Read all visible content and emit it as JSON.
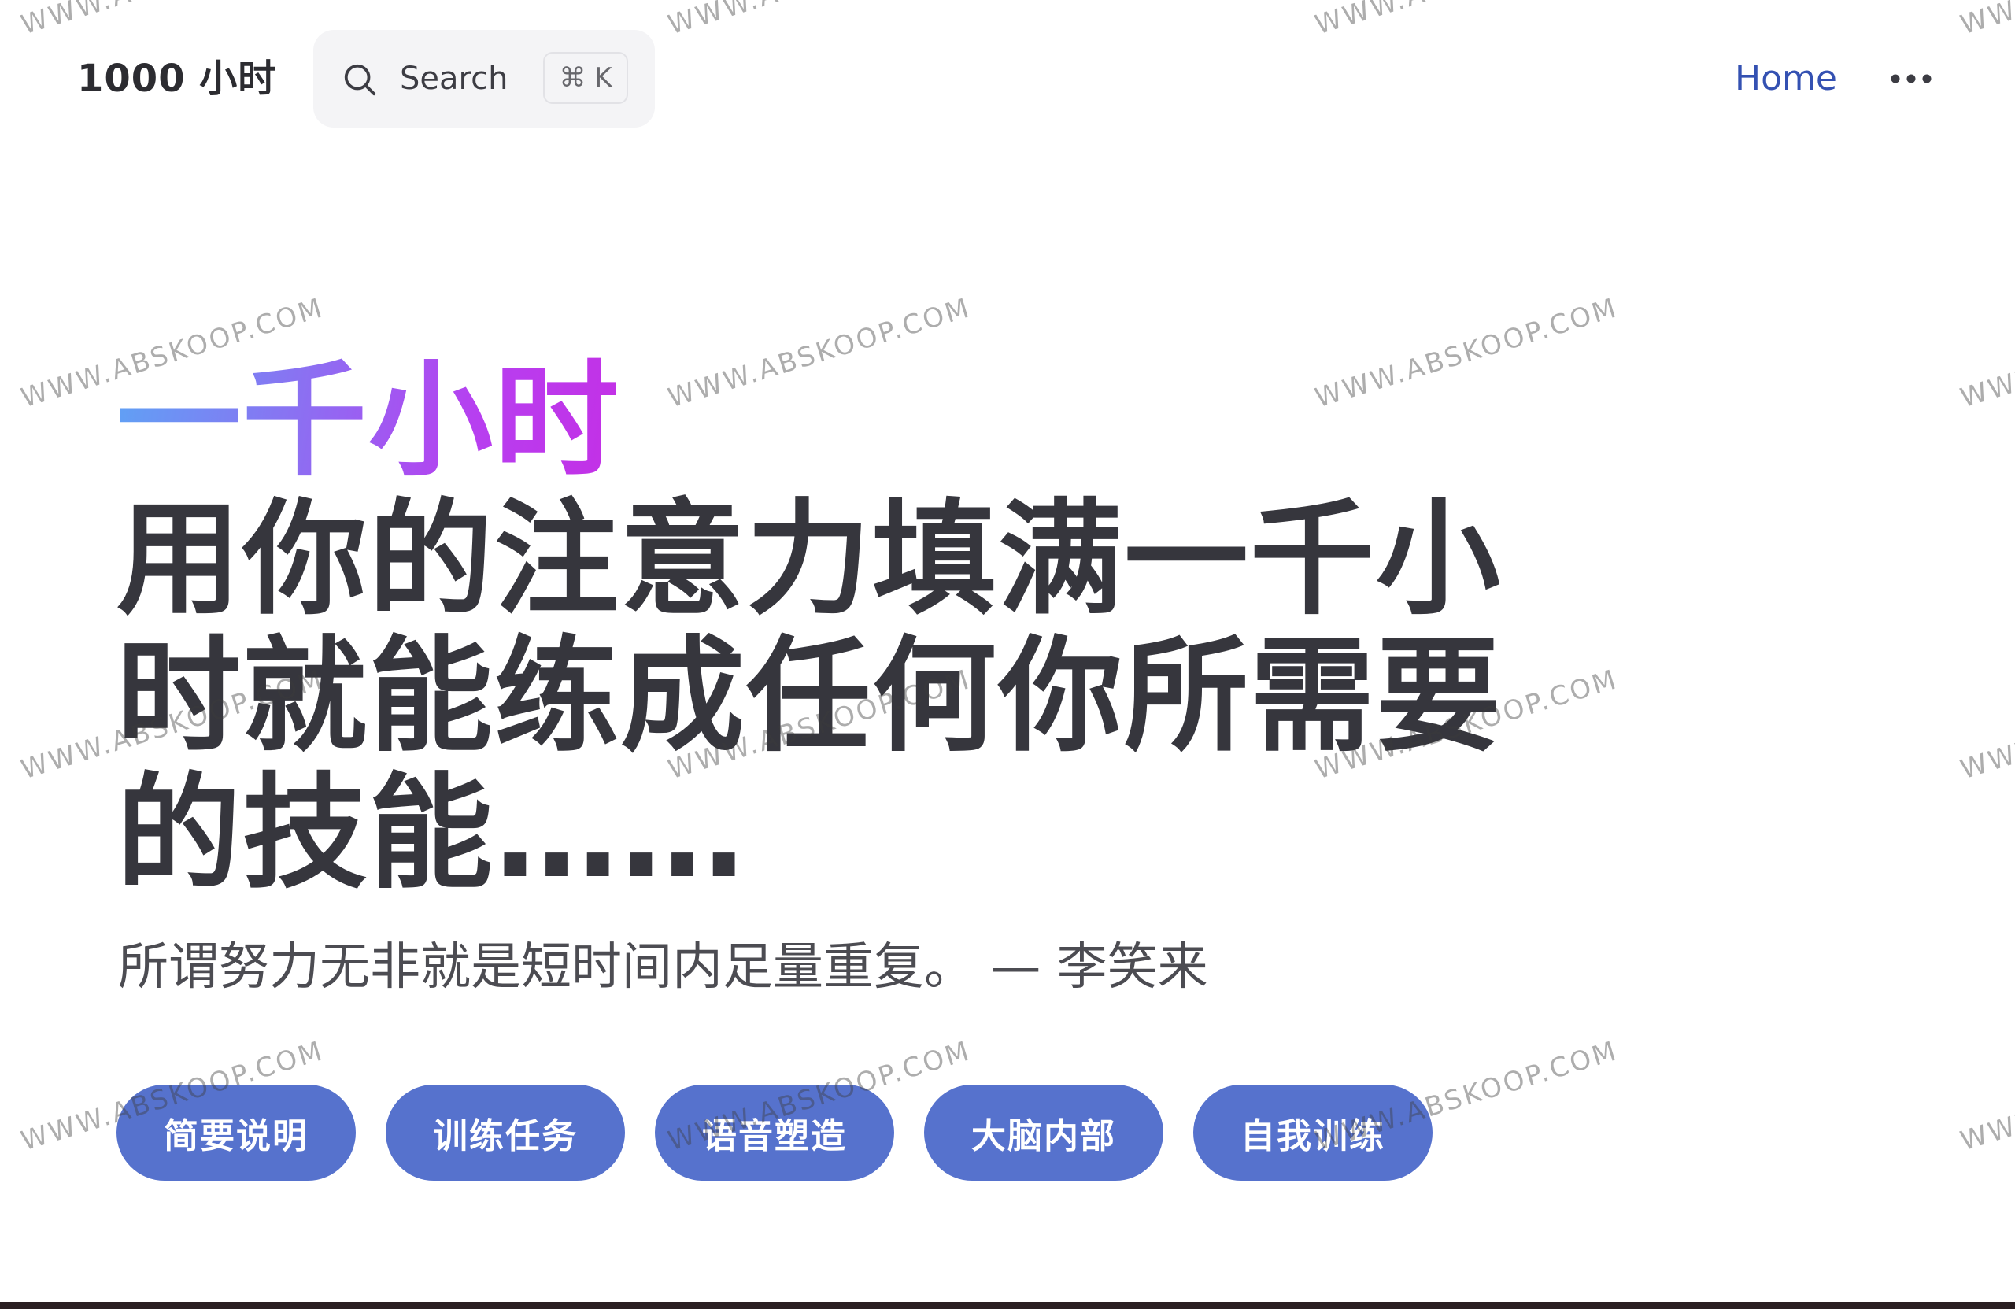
{
  "nav": {
    "site_title": "1000 小时",
    "search": {
      "label": "Search",
      "shortcut": "⌘ K"
    },
    "links": [
      {
        "label": "Home"
      }
    ],
    "more_icon": "more-horizontal-icon"
  },
  "hero": {
    "name": "一千小时",
    "text": "用你的注意力填满一千小时就能练成任何你所需要的技能……",
    "tagline": "所谓努力无非就是短时间内足量重复。 — 李笑来",
    "actions": [
      {
        "label": "简要说明"
      },
      {
        "label": "训练任务"
      },
      {
        "label": "语音塑造"
      },
      {
        "label": "大脑内部"
      },
      {
        "label": "自我训练"
      }
    ]
  },
  "watermark": "WWW.ABSKOOP.COM",
  "colors": {
    "brand": "#3451b2",
    "button_bg": "#5672cd",
    "gradient_start": "#5ea3f5",
    "gradient_end": "#c42fe5",
    "heading_text": "#36363d"
  }
}
